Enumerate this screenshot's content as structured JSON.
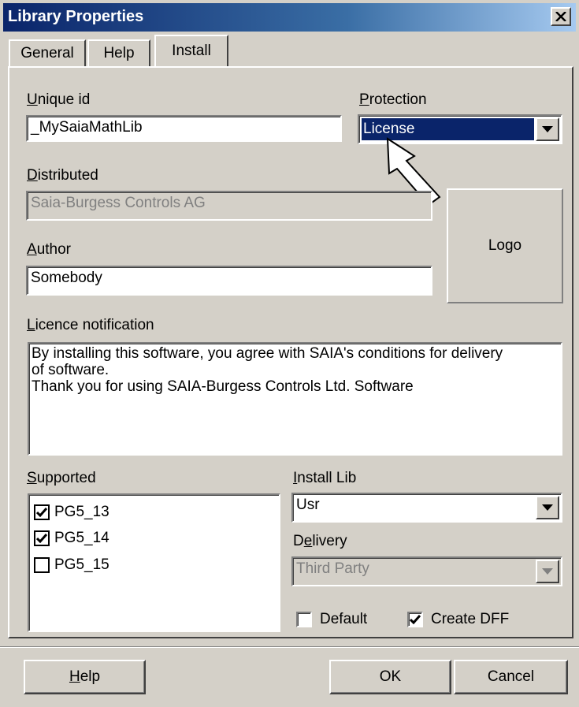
{
  "window": {
    "title": "Library Properties"
  },
  "tabs": [
    {
      "label": "General"
    },
    {
      "label": "Help"
    },
    {
      "label": "Install"
    }
  ],
  "unique_id": {
    "label_first": "U",
    "label_rest": "nique id",
    "value": "_MySaiaMathLib"
  },
  "protection": {
    "label_first": "P",
    "label_rest": "rotection",
    "value": "License"
  },
  "distributed": {
    "label_first": "D",
    "label_rest": "istributed",
    "value": "Saia-Burgess Controls AG"
  },
  "author": {
    "label_first": "A",
    "label_rest": "uthor",
    "value": "Somebody"
  },
  "logo": {
    "label": "Logo"
  },
  "licence": {
    "label_first": "L",
    "label_rest": "icence notification",
    "lines": [
      "By installing this software, you agree with SAIA's conditions for delivery",
      "of software.",
      "Thank you for using SAIA-Burgess Controls Ltd. Software"
    ]
  },
  "supported": {
    "label_first": "S",
    "label_rest": "upported",
    "items": [
      {
        "label": "PG5_13",
        "checked": true
      },
      {
        "label": "PG5_14",
        "checked": true
      },
      {
        "label": "PG5_15",
        "checked": false
      }
    ]
  },
  "install_lib": {
    "label_first": "I",
    "label_rest": "nstall Lib",
    "value": "Usr"
  },
  "delivery": {
    "label_pre": "D",
    "label_key": "e",
    "label_rest": "livery",
    "value": "Third Party"
  },
  "options": {
    "default_label": "Default",
    "default_checked": false,
    "create_dff_label": "Create DFF",
    "create_dff_checked": true
  },
  "buttons": {
    "help_first": "H",
    "help_rest": "elp",
    "ok": "OK",
    "cancel": "Cancel"
  },
  "colors": {
    "titlebar": "#0a246a",
    "face": "#d4d0c8",
    "selection": "#0a246a"
  },
  "icons": [
    "close-icon",
    "chevron-down-icon",
    "check-icon",
    "arrow-pointer-icon"
  ]
}
